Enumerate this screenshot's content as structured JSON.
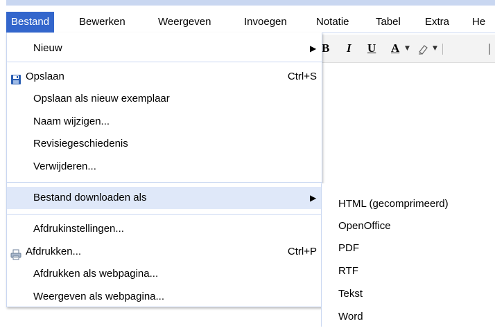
{
  "menubar": {
    "items": [
      {
        "label": "Bestand",
        "active": true
      },
      {
        "label": "Bewerken"
      },
      {
        "label": "Weergeven"
      },
      {
        "label": "Invoegen"
      },
      {
        "label": "Notatie"
      },
      {
        "label": "Tabel"
      },
      {
        "label": "Extra"
      },
      {
        "label": "He"
      }
    ]
  },
  "toolbar": {
    "bold": "B",
    "italic": "I",
    "underline": "U",
    "text_color": "A",
    "dropdown_arrow": "▼"
  },
  "file_menu": {
    "new": {
      "label": "Nieuw",
      "arrow": "▶"
    },
    "save": {
      "label": "Opslaan",
      "shortcut": "Ctrl+S"
    },
    "save_copy": {
      "label": "Opslaan als nieuw exemplaar"
    },
    "rename": {
      "label": "Naam wijzigen..."
    },
    "revision_history": {
      "label": "Revisiegeschiedenis"
    },
    "delete": {
      "label": "Verwijderen..."
    },
    "download_as": {
      "label": "Bestand downloaden als",
      "arrow": "▶"
    },
    "print_settings": {
      "label": "Afdrukinstellingen..."
    },
    "print": {
      "label": "Afdrukken...",
      "shortcut": "Ctrl+P"
    },
    "print_as_webpage": {
      "label": "Afdrukken als webpagina..."
    },
    "view_as_webpage": {
      "label": "Weergeven als webpagina..."
    }
  },
  "download_submenu": {
    "items": [
      {
        "label": "HTML (gecomprimeerd)"
      },
      {
        "label": "OpenOffice"
      },
      {
        "label": "PDF"
      },
      {
        "label": "RTF"
      },
      {
        "label": "Tekst"
      },
      {
        "label": "Word"
      }
    ]
  },
  "colors": {
    "accent": "#3366cc",
    "highlight": "#dfe8f9",
    "border": "#c9d7f1"
  }
}
